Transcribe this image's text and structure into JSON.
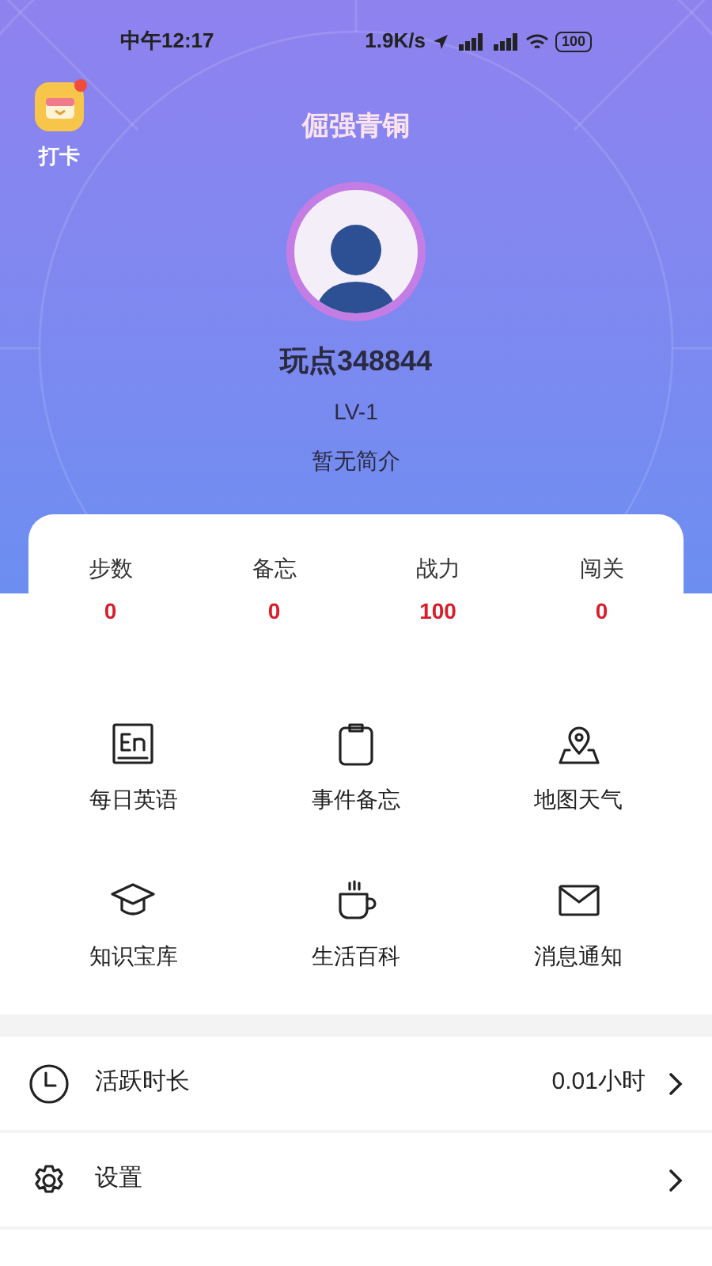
{
  "status_bar": {
    "time": "中午12:17",
    "network_speed": "1.9K/s",
    "battery": "100"
  },
  "checkin": {
    "label": "打卡",
    "badge": true
  },
  "profile": {
    "rank": "倔强青铜",
    "name": "玩点348844",
    "level": "LV-1",
    "bio": "暂无简介"
  },
  "stats": [
    {
      "label": "步数",
      "value": "0"
    },
    {
      "label": "备忘",
      "value": "0"
    },
    {
      "label": "战力",
      "value": "100"
    },
    {
      "label": "闯关",
      "value": "0"
    }
  ],
  "features": [
    {
      "kind": "english",
      "label": "每日英语"
    },
    {
      "kind": "memo",
      "label": "事件备忘"
    },
    {
      "kind": "map",
      "label": "地图天气"
    },
    {
      "kind": "knowledge",
      "label": "知识宝库"
    },
    {
      "kind": "life",
      "label": "生活百科"
    },
    {
      "kind": "message",
      "label": "消息通知"
    }
  ],
  "menu": [
    {
      "kind": "clock",
      "label": "活跃时长",
      "value": "0.01小时"
    },
    {
      "kind": "settings",
      "label": "设置"
    }
  ]
}
